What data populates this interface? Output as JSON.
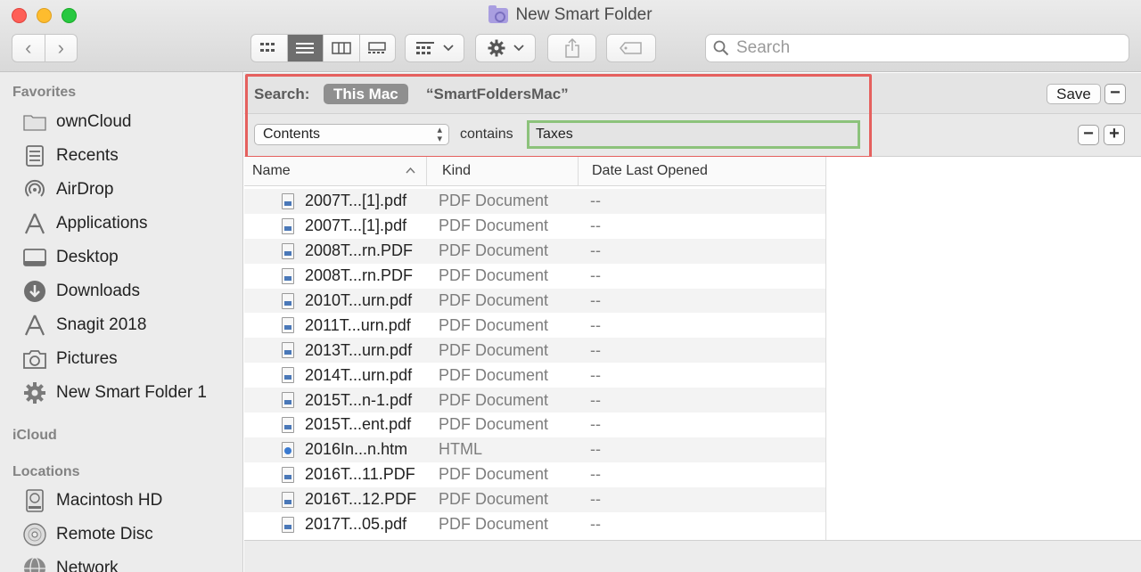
{
  "window": {
    "title": "New Smart Folder"
  },
  "toolbar": {
    "back_glyph": "‹",
    "forward_glyph": "›",
    "search_placeholder": "Search"
  },
  "sidebar": {
    "favorites_label": "Favorites",
    "favorites": [
      {
        "label": "ownCloud",
        "icon": "folder-icon"
      },
      {
        "label": "Recents",
        "icon": "recents-icon"
      },
      {
        "label": "AirDrop",
        "icon": "airdrop-icon"
      },
      {
        "label": "Applications",
        "icon": "applications-icon"
      },
      {
        "label": "Desktop",
        "icon": "desktop-icon"
      },
      {
        "label": "Downloads",
        "icon": "downloads-icon"
      },
      {
        "label": "Snagit 2018",
        "icon": "applications-icon"
      },
      {
        "label": "Pictures",
        "icon": "camera-icon"
      },
      {
        "label": "New Smart Folder 1",
        "icon": "gear-icon"
      }
    ],
    "icloud_label": "iCloud",
    "locations_label": "Locations",
    "locations": [
      {
        "label": "Macintosh HD",
        "icon": "hard-drive-icon"
      },
      {
        "label": "Remote Disc",
        "icon": "disc-icon"
      },
      {
        "label": "Network",
        "icon": "network-icon"
      }
    ]
  },
  "search_bar": {
    "label": "Search:",
    "scope_selected": "This Mac",
    "scope_query": "“SmartFoldersMac”",
    "save_label": "Save",
    "minus_label": "−",
    "plus_label": "+"
  },
  "criteria": {
    "attribute": "Contents",
    "operator": "contains",
    "value": "Taxes"
  },
  "list": {
    "columns": {
      "name": "Name",
      "kind": "Kind",
      "date": "Date Last Opened"
    },
    "rows": [
      {
        "name": "2007T...[1].pdf",
        "kind": "PDF Document",
        "date": "--",
        "type": "pdf"
      },
      {
        "name": "2007T...[1].pdf",
        "kind": "PDF Document",
        "date": "--",
        "type": "pdf"
      },
      {
        "name": "2008T...rn.PDF",
        "kind": "PDF Document",
        "date": "--",
        "type": "pdf"
      },
      {
        "name": "2008T...rn.PDF",
        "kind": "PDF Document",
        "date": "--",
        "type": "pdf"
      },
      {
        "name": "2010T...urn.pdf",
        "kind": "PDF Document",
        "date": "--",
        "type": "pdf"
      },
      {
        "name": "2011T...urn.pdf",
        "kind": "PDF Document",
        "date": "--",
        "type": "pdf"
      },
      {
        "name": "2013T...urn.pdf",
        "kind": "PDF Document",
        "date": "--",
        "type": "pdf"
      },
      {
        "name": "2014T...urn.pdf",
        "kind": "PDF Document",
        "date": "--",
        "type": "pdf"
      },
      {
        "name": "2015T...n-1.pdf",
        "kind": "PDF Document",
        "date": "--",
        "type": "pdf"
      },
      {
        "name": "2015T...ent.pdf",
        "kind": "PDF Document",
        "date": "--",
        "type": "pdf"
      },
      {
        "name": "2016In...n.htm",
        "kind": "HTML",
        "date": "--",
        "type": "htm"
      },
      {
        "name": "2016T...11.PDF",
        "kind": "PDF Document",
        "date": "--",
        "type": "pdf"
      },
      {
        "name": "2016T...12.PDF",
        "kind": "PDF Document",
        "date": "--",
        "type": "pdf"
      },
      {
        "name": "2017T...05.pdf",
        "kind": "PDF Document",
        "date": "--",
        "type": "pdf"
      }
    ]
  },
  "colors": {
    "highlight_red": "#e5605e",
    "highlight_green": "#8cc27b",
    "scope_pill": "#8f8f8f"
  }
}
